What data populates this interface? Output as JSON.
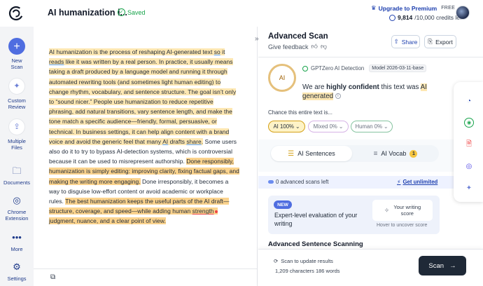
{
  "header": {
    "doc_title": "AI humanization i...",
    "saved_label": "Saved",
    "upgrade_label": "Upgrade to Premium",
    "plan_badge": "FREE",
    "credits_used": "9,814",
    "credits_rest": "/10,000 credits left"
  },
  "sidebar": {
    "items": [
      {
        "label_1": "New",
        "label_2": "Scan"
      },
      {
        "label_1": "Custom",
        "label_2": "Review"
      },
      {
        "label_1": "Multiple",
        "label_2": "Files"
      },
      {
        "label_1": "Documents"
      },
      {
        "label_1": "Chrome",
        "label_2": "Extension"
      },
      {
        "label_1": "More"
      },
      {
        "label_1": "Settings"
      }
    ]
  },
  "editor": {
    "t1a": "AI humanization is the process of reshaping AI-generated text ",
    "t1b": "so",
    "t1c": " it ",
    "t1d": "reads",
    "t1e": " like it was written by a real person. In practice, it usually means taking a draft produced by a language model and running it through automated rewriting tools (and sometimes light human editing) to change rhythm, vocabulary, and sentence structure. The goal isn’t only to “sound nicer.” People use humanization to reduce repetitive phrasing, add natural transitions, vary sentence length, and make the tone match a specific audience—friendly, formal, persuasive, or technical. In business settings, it can help align content with a brand voice and avoid the generic feel that many ",
    "t1f": "AI",
    "t1g": " drafts ",
    "t1h": "share",
    "t1i": ".",
    "t2": " Some users also do it to try to bypass AI-detection systems, which is controversial because it can be used to misrepresent authorship. ",
    "t3": "Done responsibly, humanization is simply editing: improving clarity, fixing factual gaps, and making the writing more engaging.",
    "t4": " Done irresponsibly, it becomes a way to disguise low-effort content or avoid academic or workplace rules. ",
    "t5": "The best humanization keeps the useful parts of the AI draft—structure, coverage, and speed—while adding human ",
    "t5b": "strength",
    "t5c": " judgment, nuance, and a clear point of view."
  },
  "panel": {
    "title": "Advanced Scan",
    "feedback": "Give feedback",
    "share": "Share",
    "export": "Export",
    "ring_label": "AI",
    "detector_name": "GPTZero AI Detection",
    "model": "Model 2026-03-11-base",
    "verdict_a": "We are ",
    "verdict_b": "highly confident",
    "verdict_c": " this text was ",
    "verdict_d": "AI generated",
    "chance_label": "Chance this entire text is...",
    "pill_ai": "AI 100%",
    "pill_mixed": "Mixed 0%",
    "pill_human": "Human 0%",
    "tab_sentences": "AI Sentences",
    "tab_vocab": "AI Vocab",
    "vocab_count": "1",
    "adv_scans": "0 advanced scans left",
    "get_unlimited": "Get unlimited",
    "new_badge": "NEW",
    "promo_text": "Expert-level evaluation of your writing",
    "score_card_1": "Your writing",
    "score_card_2": "score",
    "hover_hint": "Hover to uncover score",
    "adv_heading": "Advanced Sentence Scanning",
    "scan_hint": "Scan to update results",
    "char_count": "1,209 characters 186 words",
    "scan_button": "Scan"
  },
  "colors": {
    "accent": "#4f6de0",
    "ai_highlight": "#fde7b2",
    "ai_highlight_strong": "#fbd38d",
    "scan_button": "#1f2937"
  }
}
